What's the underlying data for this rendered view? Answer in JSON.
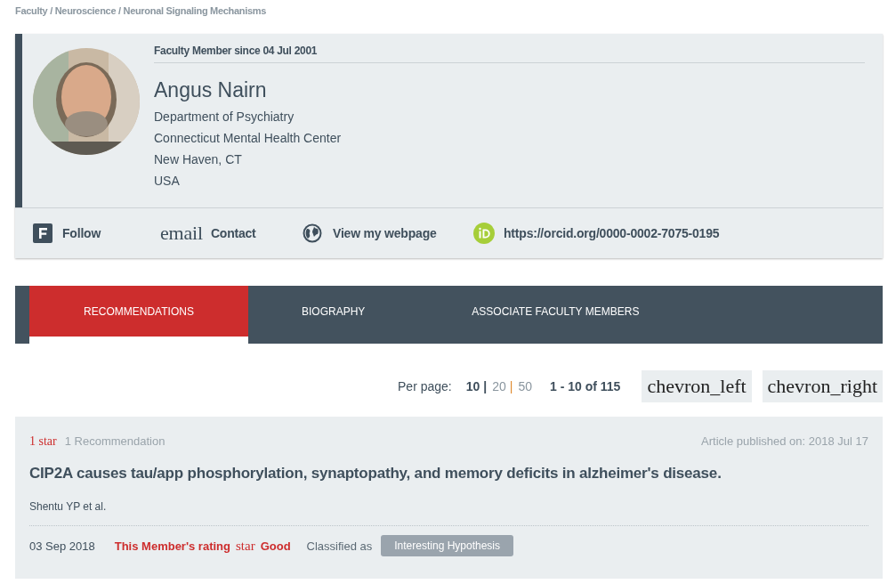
{
  "breadcrumb": "Faculty / Neuroscience / Neuronal Signaling Mechanisms",
  "profile": {
    "member_since": "Faculty Member since 04 Jul 2001",
    "name": "Angus Nairn",
    "lines": [
      "Department of Psychiatry",
      "Connecticut Mental Health Center",
      "New Haven, CT",
      "USA"
    ]
  },
  "actions": [
    {
      "kind": "follow",
      "label": "Follow"
    },
    {
      "kind": "contact",
      "icon_text": "email",
      "label": "Contact"
    },
    {
      "kind": "web",
      "label": "View my webpage"
    },
    {
      "kind": "orcid",
      "label": "https://orcid.org/0000-0002-7075-0195"
    }
  ],
  "tabs": [
    {
      "label": "RECOMMENDATIONS",
      "selected": true
    },
    {
      "label": "BIOGRAPHY",
      "selected": false
    },
    {
      "label": "ASSOCIATE FACULTY MEMBERS",
      "selected": false
    }
  ],
  "pagination": {
    "per_page_label": "Per page:",
    "options": [
      {
        "label": "10",
        "selected": true,
        "separator": "|"
      },
      {
        "label": "20",
        "selected": false,
        "separator": "|"
      },
      {
        "label": "50",
        "selected": false
      }
    ],
    "range": "1 - 10 of 115",
    "prev": "chevron_left",
    "next": "chevron_right"
  },
  "articles": [
    {
      "stars_text": "1 star",
      "recommendations": "1 Recommendation",
      "published": "Article published on: 2018 Jul 17",
      "title": "CIP2A causes tau/app phosphorylation, synaptopathy, and memory deficits in alzheimer's disease.",
      "authors": "Shentu YP et al.",
      "date": "03 Sep 2018",
      "rating_label": "This Member's rating",
      "rating_icon": "star",
      "rating": "Good",
      "classified_label": "Classified as",
      "classification": "Interesting Hypothesis"
    }
  ]
}
